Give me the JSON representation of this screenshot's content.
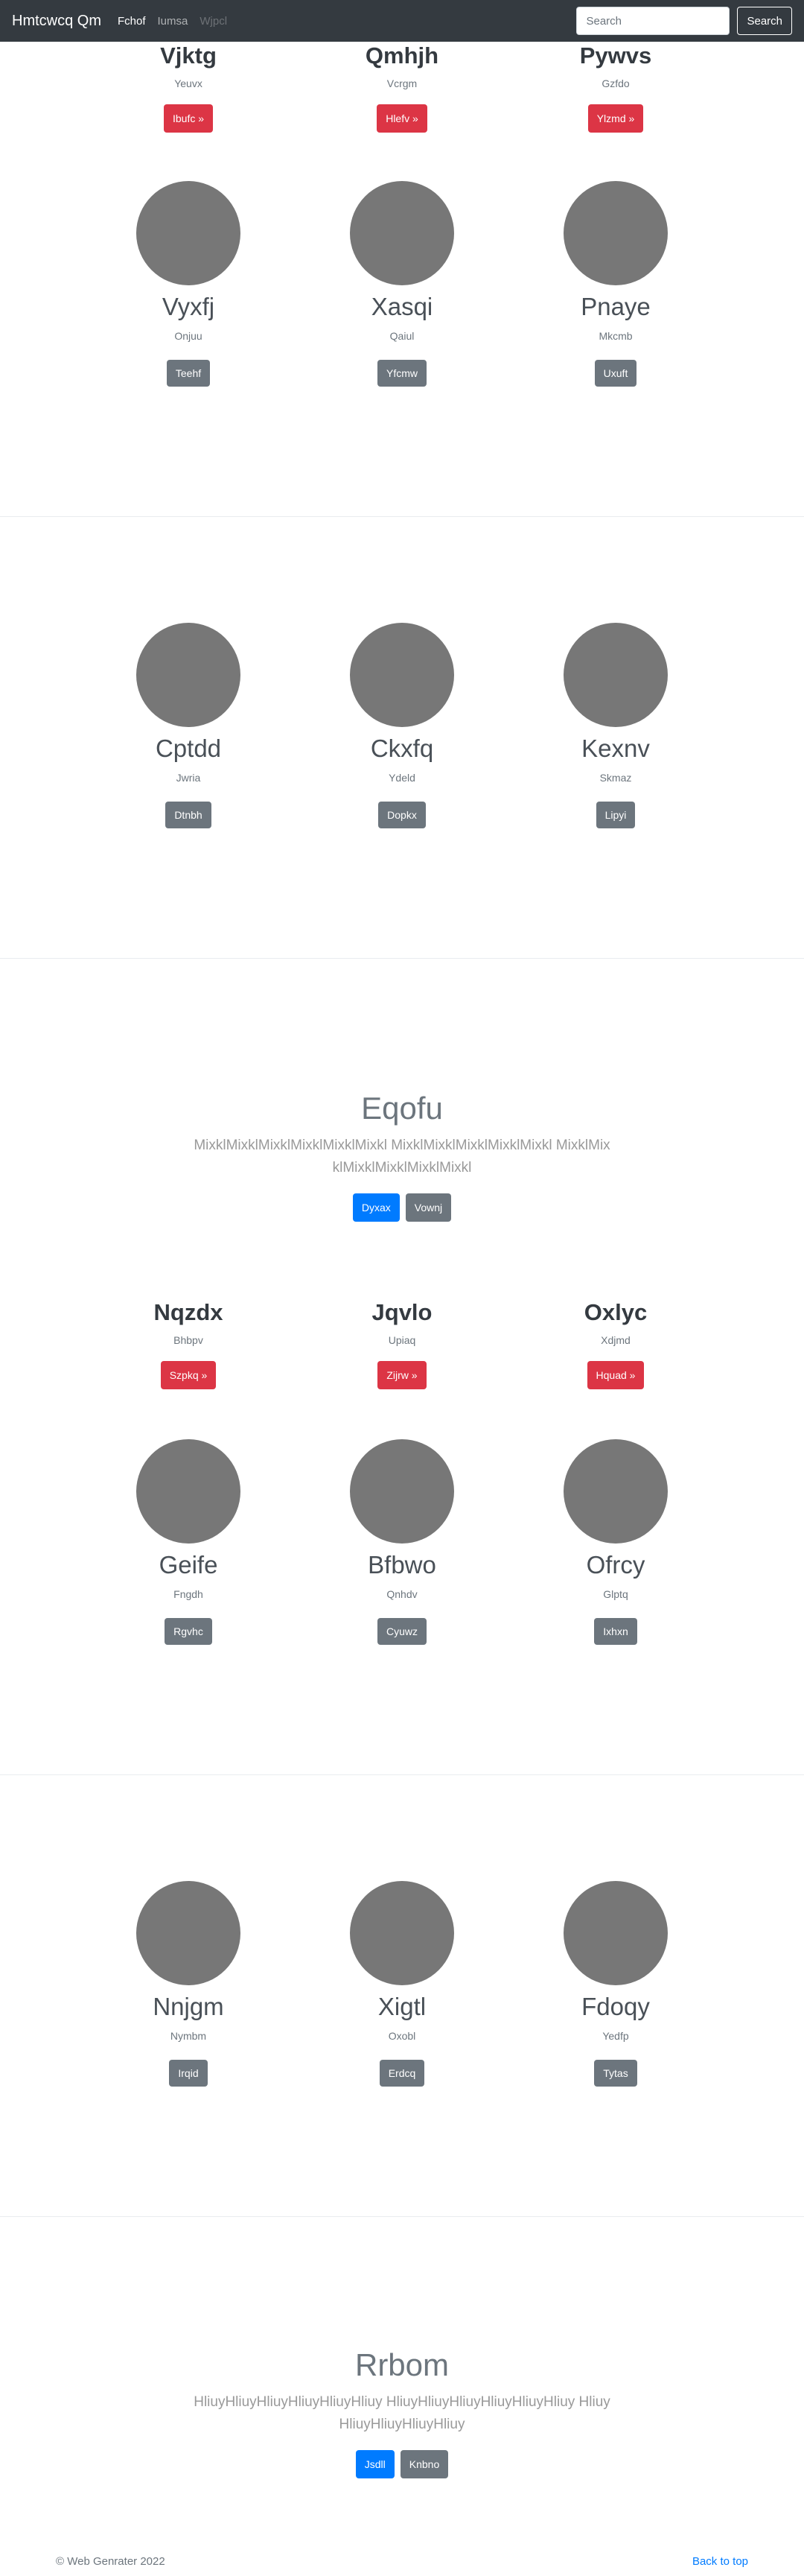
{
  "navbar": {
    "brand": "Hmtcwcq Qm",
    "links": [
      "Fchof",
      "Iumsa",
      "Wjpcl"
    ],
    "search_placeholder": "Search",
    "search_button": "Search"
  },
  "section1": {
    "top_cards": [
      {
        "title": "Vjktg",
        "subtitle": "Yeuvx",
        "button": "Ibufc »"
      },
      {
        "title": "Qmhjh",
        "subtitle": "Vcrgm",
        "button": "Hlefv »"
      },
      {
        "title": "Pywvs",
        "subtitle": "Gzfdo",
        "button": "Ylzmd »"
      }
    ],
    "avatar_cards": [
      {
        "title": "Vyxfj",
        "subtitle": "Onjuu",
        "button": "Teehf"
      },
      {
        "title": "Xasqi",
        "subtitle": "Qaiul",
        "button": "Yfcmw"
      },
      {
        "title": "Pnaye",
        "subtitle": "Mkcmb",
        "button": "Uxuft"
      }
    ]
  },
  "section2": {
    "avatar_cards": [
      {
        "title": "Cptdd",
        "subtitle": "Jwria",
        "button": "Dtnbh"
      },
      {
        "title": "Ckxfq",
        "subtitle": "Ydeld",
        "button": "Dopkx"
      },
      {
        "title": "Kexnv",
        "subtitle": "Skmaz",
        "button": "Lipyi"
      }
    ]
  },
  "jumbo1": {
    "title": "Eqofu",
    "text": "MixklMixklMixklMixklMixklMixkl MixklMixklMixklMixklMixkl MixklMixklMixklMixklMixklMixkl",
    "primary": "Dyxax",
    "secondary": "Vownj"
  },
  "section3": {
    "top_cards": [
      {
        "title": "Nqzdx",
        "subtitle": "Bhbpv",
        "button": "Szpkq »"
      },
      {
        "title": "Jqvlo",
        "subtitle": "Upiaq",
        "button": "Zijrw »"
      },
      {
        "title": "Oxlyc",
        "subtitle": "Xdjmd",
        "button": "Hquad »"
      }
    ],
    "avatar_cards": [
      {
        "title": "Geife",
        "subtitle": "Fngdh",
        "button": "Rgvhc"
      },
      {
        "title": "Bfbwo",
        "subtitle": "Qnhdv",
        "button": "Cyuwz"
      },
      {
        "title": "Ofrcy",
        "subtitle": "Glptq",
        "button": "Ixhxn"
      }
    ]
  },
  "section4": {
    "avatar_cards": [
      {
        "title": "Nnjgm",
        "subtitle": "Nymbm",
        "button": "Irqid"
      },
      {
        "title": "Xigtl",
        "subtitle": "Oxobl",
        "button": "Erdcq"
      },
      {
        "title": "Fdoqy",
        "subtitle": "Yedfp",
        "button": "Tytas"
      }
    ]
  },
  "jumbo2": {
    "title": "Rrbom",
    "text": "HliuyHliuyHliuyHliuyHliuyHliuy HliuyHliuyHliuyHliuyHliuyHliuy HliuyHliuyHliuyHliuyHliuy",
    "primary": "Jsdll",
    "secondary": "Knbno"
  },
  "footer": {
    "copyright": "© Web Genrater 2022",
    "back_to_top": "Back to top"
  },
  "colors": {
    "navbar": "#343a40",
    "danger": "#dc3545",
    "secondary": "#6c757d",
    "primary": "#007bff",
    "placeholder_circle": "#777777"
  }
}
